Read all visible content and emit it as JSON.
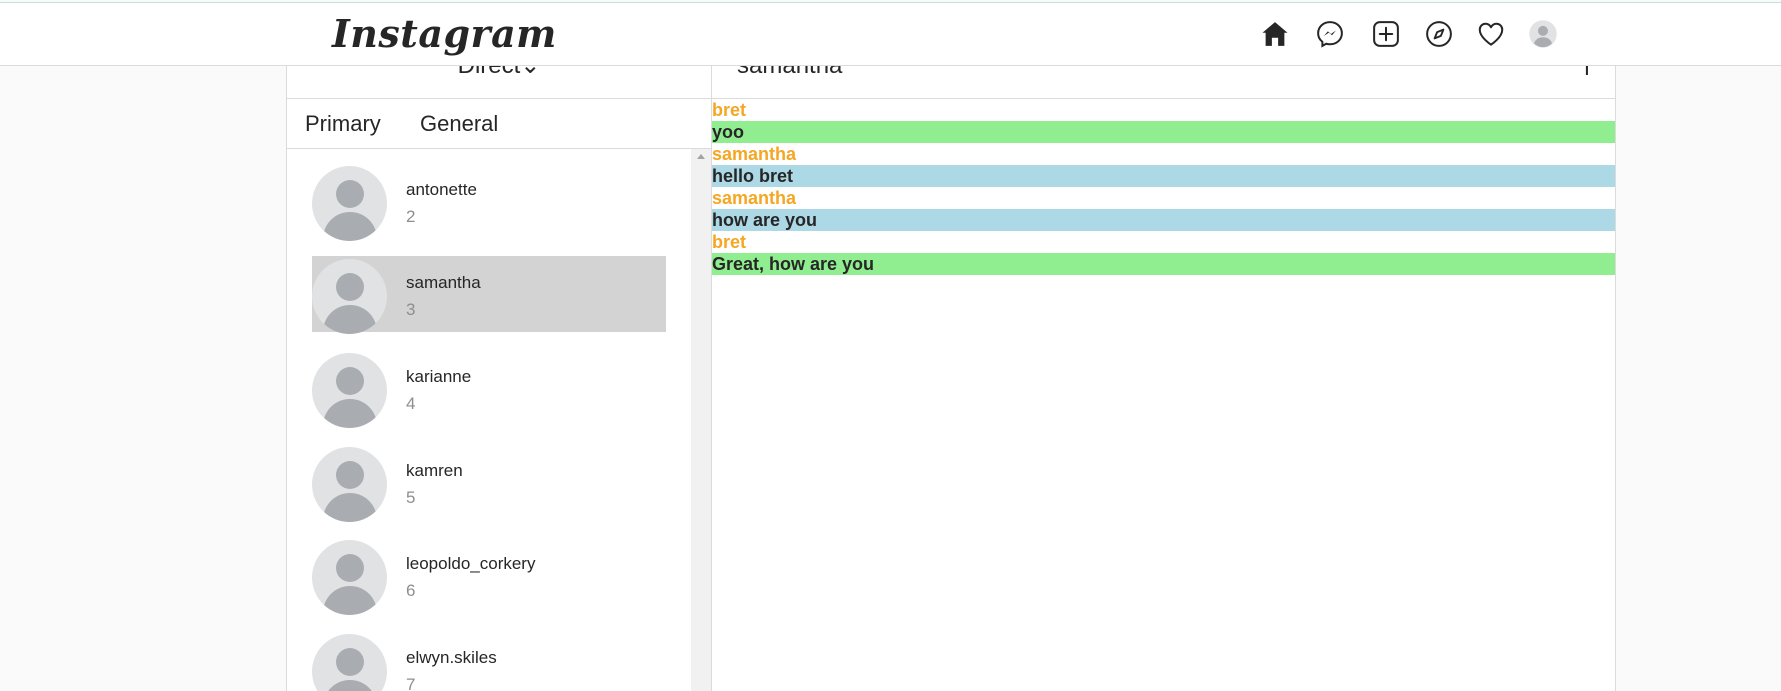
{
  "app": {
    "logo": "Instagram"
  },
  "nav": {
    "icons": [
      {
        "name": "home-icon"
      },
      {
        "name": "messenger-icon"
      },
      {
        "name": "new-post-icon"
      },
      {
        "name": "explore-icon"
      },
      {
        "name": "activity-heart-icon"
      },
      {
        "name": "profile-avatar-icon"
      }
    ]
  },
  "inbox": {
    "title": "Direct⌄",
    "tabs": [
      {
        "label": "Primary"
      },
      {
        "label": "General"
      }
    ],
    "conversations": [
      {
        "name": "antonette",
        "sub": "2"
      },
      {
        "name": "samantha",
        "sub": "3",
        "selected": true
      },
      {
        "name": "karianne",
        "sub": "4"
      },
      {
        "name": "kamren",
        "sub": "5"
      },
      {
        "name": "leopoldo_corkery",
        "sub": "6"
      },
      {
        "name": "elwyn.skiles",
        "sub": "7"
      }
    ]
  },
  "chat": {
    "name": "samantha",
    "info": "I",
    "messages": [
      {
        "sender": "bret",
        "text": "yoo",
        "from_self": false
      },
      {
        "sender": "samantha",
        "text": "hello bret",
        "from_self": true
      },
      {
        "sender": "samantha",
        "text": "how are you",
        "from_self": true
      },
      {
        "sender": "bret",
        "text": "Great, how are you",
        "from_self": false
      }
    ]
  },
  "colors": {
    "sender": "#f5a623",
    "other_bubble": "#90ee90",
    "self_bubble": "#add8e6",
    "selected_row": "#d3d3d3"
  }
}
